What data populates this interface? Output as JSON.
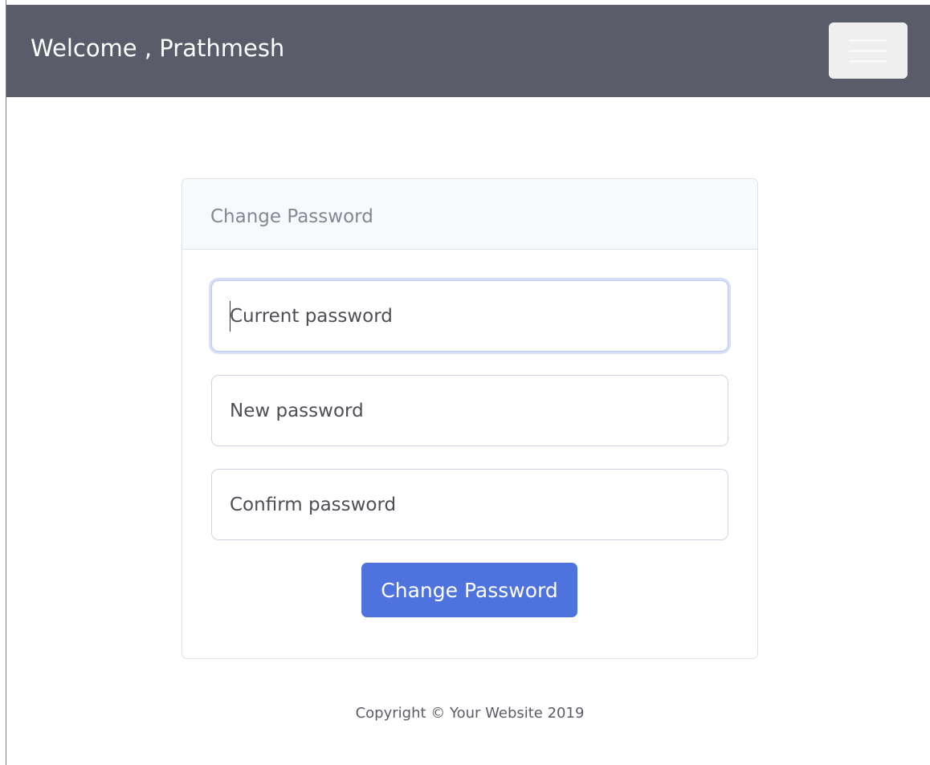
{
  "navbar": {
    "brand": "Welcome , Prathmesh",
    "toggle_icon": "hamburger-menu-icon"
  },
  "card": {
    "title": "Change Password",
    "fields": {
      "current": {
        "placeholder": "Current password",
        "value": ""
      },
      "new": {
        "placeholder": "New password",
        "value": ""
      },
      "confirm": {
        "placeholder": "Confirm password",
        "value": ""
      }
    },
    "submit_label": "Change Password"
  },
  "footer": {
    "copyright": "Copyright © Your Website 2019"
  },
  "colors": {
    "navbar_bg": "#5a5c69",
    "primary": "#4e73df",
    "header_bg": "#f8f9fc",
    "muted_text": "#858796"
  }
}
